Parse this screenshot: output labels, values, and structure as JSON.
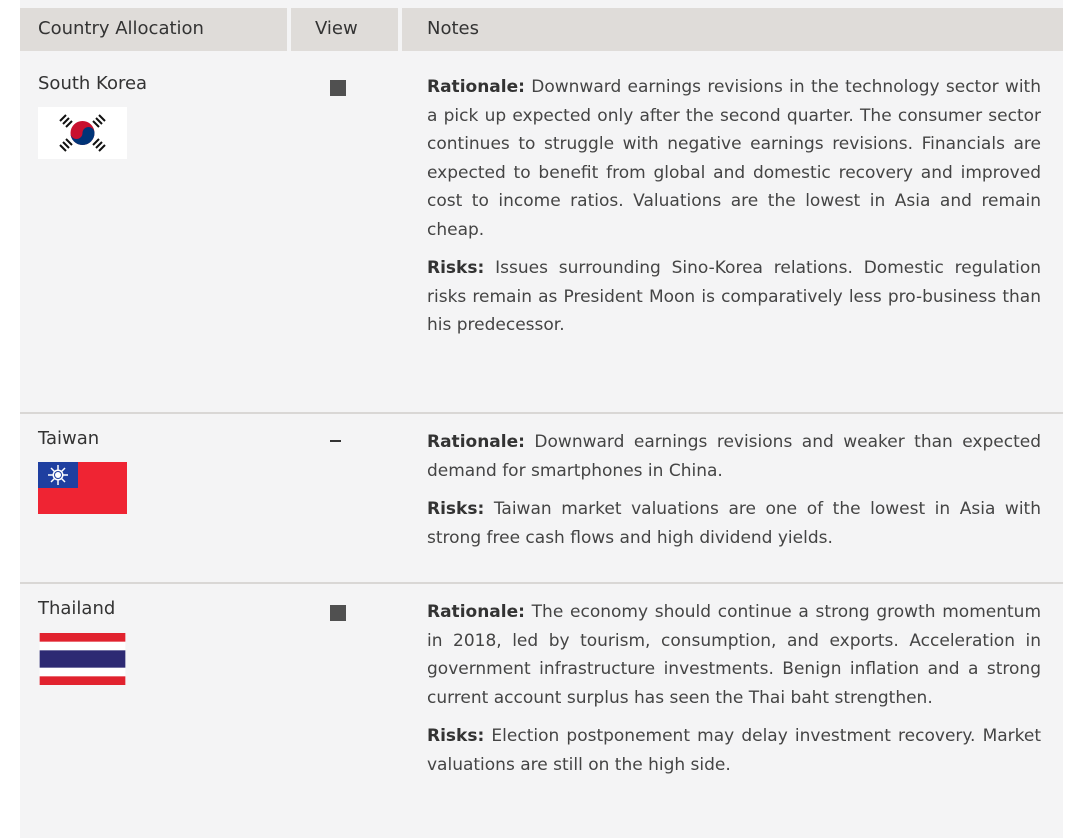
{
  "header": {
    "col_country": "Country Allocation",
    "col_view": "View",
    "col_notes": "Notes"
  },
  "rows": [
    {
      "country": "South Korea",
      "flag_icon": "south-korea-flag",
      "view": "square",
      "rationale_label": "Rationale:",
      "rationale_text": "Downward earnings revisions in the technology sector with a pick up expected only after the second quarter. The consumer sector continues to struggle with negative earnings revisions. Financials are expected to benefit from global and domestic recovery and improved cost to income ratios. Valuations are the lowest in Asia and remain cheap.",
      "risks_label": "Risks:",
      "risks_text": "Issues surrounding Sino-Korea relations. Domestic regulation risks remain as President Moon is comparatively less pro-business than his predecessor."
    },
    {
      "country": "Taiwan",
      "flag_icon": "taiwan-flag",
      "view": "dash",
      "rationale_label": "Rationale:",
      "rationale_text": "Downward earnings revisions and weaker than expected demand for smartphones in China.",
      "risks_label": "Risks:",
      "risks_text": "Taiwan market valuations are one of the lowest in Asia with strong free cash flows and high dividend yields."
    },
    {
      "country": "Thailand",
      "flag_icon": "thailand-flag",
      "view": "square",
      "rationale_label": "Rationale:",
      "rationale_text": "The economy should continue a strong growth momentum in 2018, led by tourism, consumption, and exports. Acceleration in government infrastructure investments. Benign inflation and a strong current account surplus has seen the Thai baht strengthen.",
      "risks_label": "Risks:",
      "risks_text": "Election postponement may delay investment recovery. Market valuations are still on the high side."
    }
  ],
  "colors": {
    "header_bg": "#dfdcd9",
    "sheet_bg": "#f4f4f5",
    "view_marker": "#505050"
  }
}
